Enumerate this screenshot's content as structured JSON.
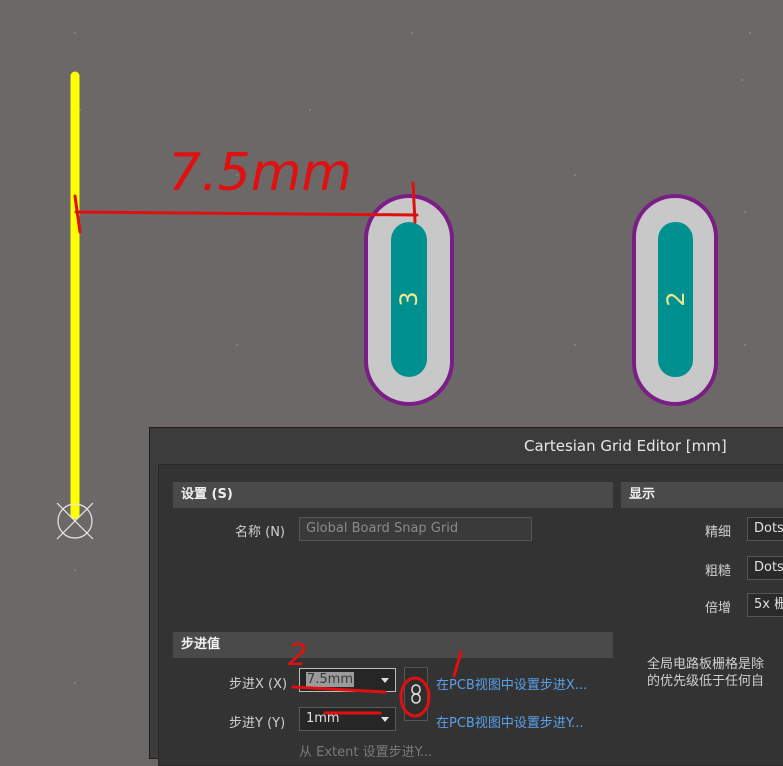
{
  "canvas": {
    "pad_left_designator": "3",
    "pad_right_designator": "2",
    "annotation_measure": "7.5mm",
    "annotation_num_1": "1",
    "annotation_num_2": "2"
  },
  "dialog": {
    "title": "Cartesian Grid Editor [mm]",
    "settings": {
      "header": "设置 (S)",
      "name_label": "名称 (N)",
      "name_value": "Global Board Snap Grid"
    },
    "steps": {
      "header": "步进值",
      "step_x_label": "步进X (X)",
      "step_x_value": "7.5mm",
      "step_y_label": "步进Y (Y)",
      "step_y_value": "1mm",
      "set_x_link": "在PCB视图中设置步进X...",
      "set_y_link": "在PCB视图中设置步进Y...",
      "cut_off_text": "从 Extent 设置步进Y..."
    },
    "display": {
      "header": "显示",
      "fine_label": "精细",
      "fine_value": "Dots",
      "coarse_label": "粗糙",
      "coarse_value": "Dots",
      "multiplier_label": "倍增",
      "multiplier_value": "5x 栅",
      "note_line1": "全局电路板栅格是除",
      "note_line2": "的优先级低于任何自"
    }
  },
  "colors": {
    "canvas_bg": "#6b6867",
    "track": "#ffff00",
    "pad_outline": "#7a1e86",
    "pad_body": "#c8c8c8",
    "pad_hole": "#00908f",
    "annotation": "#e01010",
    "link": "#5aa0e8"
  }
}
